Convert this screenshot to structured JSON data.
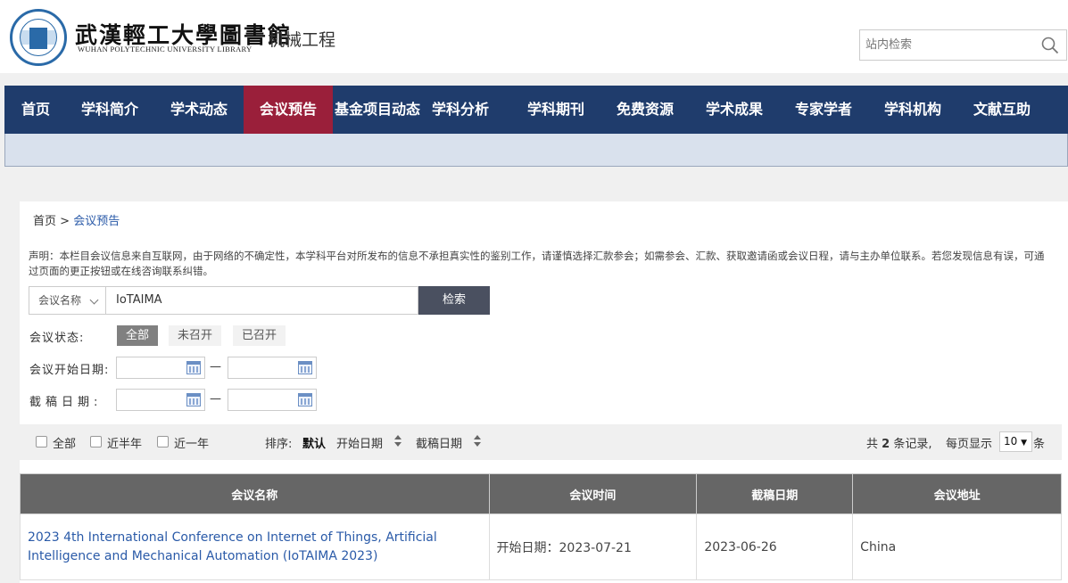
{
  "header": {
    "library_name": "武漢輕工大學圖書館",
    "library_name_en": "WUHAN POLYTECHNIC UNIVERSITY LIBRARY",
    "site_title": "机械工程",
    "search_placeholder": "站内检索"
  },
  "nav": {
    "items": [
      "首页",
      "学科简介",
      "学术动态",
      "会议预告",
      "基金项目动态",
      "学科分析",
      "学科期刊",
      "免费资源",
      "学术成果",
      "专家学者",
      "学科机构",
      "文献互助"
    ],
    "active_index": 3
  },
  "breadcrumb": {
    "home": "首页",
    "separator": ">",
    "current": "会议预告"
  },
  "notice": "声明：本栏目会议信息来自互联网，由于网络的不确定性，本学科平台对所发布的信息不承担真实性的鉴别工作，请谨慎选择汇款参会；如需参会、汇款、获取邀请函或会议日程，请与主办单位联系。若您发现信息有误，可通过页面的更正按钮或在线咨询联系纠错。",
  "search": {
    "field_select": "会议名称",
    "query": "IoTAIMA",
    "button": "检索"
  },
  "filters": {
    "status_label": "会议状态:",
    "status_options": [
      "全部",
      "未召开",
      "已召开"
    ],
    "status_selected": "全部",
    "start_date_label": "会议开始日期:",
    "deadline_label": "截稿日期:",
    "range_dash": "—"
  },
  "toolbar": {
    "checks": [
      "全部",
      "近半年",
      "近一年"
    ],
    "sort_label": "排序:",
    "sort_default": "默认",
    "sort_start": "开始日期",
    "sort_deadline": "截稿日期",
    "total_prefix": "共",
    "total_count": "2",
    "total_suffix": "条记录,",
    "per_page_prefix": "每页显示",
    "per_page_value": "10",
    "per_page_suffix": "条"
  },
  "table": {
    "headers": [
      "会议名称",
      "会议时间",
      "截稿日期",
      "会议地址"
    ],
    "rows": [
      {
        "name": "2023 4th International Conference on Internet of Things, Artificial Intelligence and Mechanical Automation (IoTAIMA 2023)",
        "time": "开始日期：2023-07-21",
        "deadline": "2023-06-26",
        "location": "China"
      }
    ]
  },
  "colors": {
    "nav_bg": "#1f3c6c",
    "nav_active": "#9a1f3a",
    "link": "#2a5aa8",
    "table_header": "#666666"
  }
}
